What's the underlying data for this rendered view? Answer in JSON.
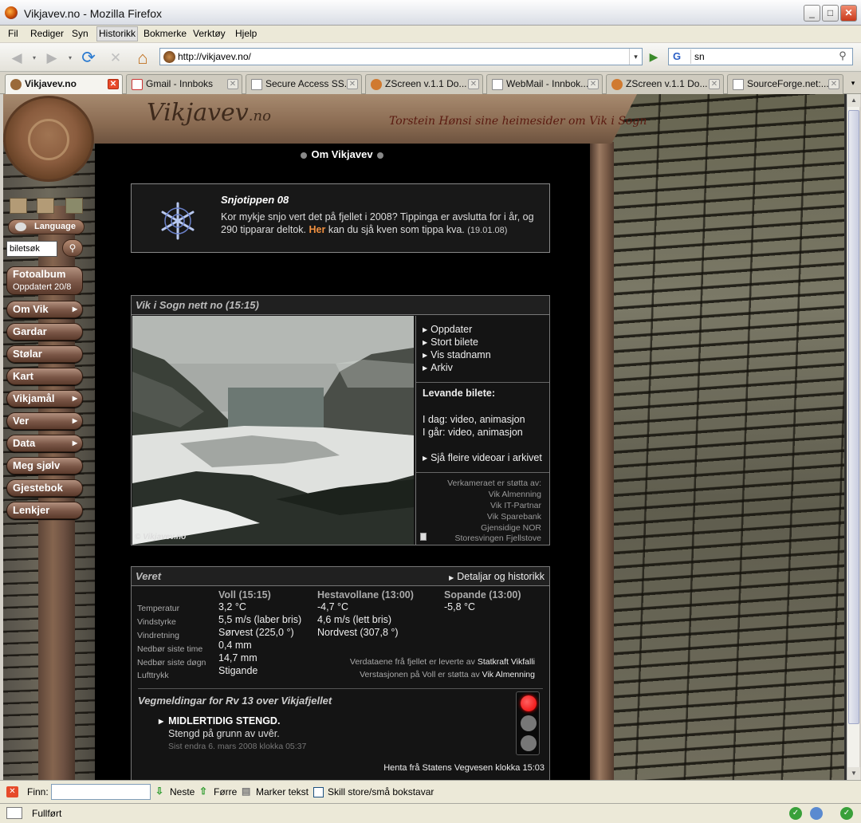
{
  "window": {
    "title": "Vikjavev.no - Mozilla Firefox",
    "min": "_",
    "max": "□",
    "close": "✕"
  },
  "menu": [
    "Fil",
    "Rediger",
    "Syn",
    "Historikk",
    "Bokmerke",
    "Verktøy",
    "Hjelp"
  ],
  "nav": {
    "back": "◀",
    "forward": "▶",
    "reload": "⟳",
    "stop": "✕",
    "home": "⌂",
    "url": "http://vikjavev.no/",
    "go": "▶",
    "search_engine": "G",
    "search_value": "sn",
    "dropdown": "▾",
    "search_btn": "⚲"
  },
  "tabs": [
    {
      "label": "Vikjavev.no",
      "active": true
    },
    {
      "label": "Gmail - Innboks",
      "active": false
    },
    {
      "label": "Secure Access SS...",
      "active": false
    },
    {
      "label": "ZScreen v.1.1 Do...",
      "active": false
    },
    {
      "label": "WebMail - Innbok...",
      "active": false
    },
    {
      "label": "ZScreen v.1.1 Do...",
      "active": false
    },
    {
      "label": "SourceForge.net:...",
      "active": false
    }
  ],
  "tab_close": "✕",
  "tab_list": "▾",
  "site": {
    "logo": "Vikjavev",
    "logo_suffix": ".no",
    "tagline": "Torstein Hønsi sine heimesider om Vik i Sogn",
    "page_title": "Om Vikjavev",
    "language": "Language",
    "image_search_placeholder": "biletsøk",
    "search_btn": "⚲",
    "fotoalbum": {
      "title": "Fotoalbum",
      "sub": "Oppdatert 20/8"
    },
    "nav_items": [
      {
        "label": "Om Vik",
        "arrow": "▶"
      },
      {
        "label": "Gardar",
        "arrow": ""
      },
      {
        "label": "Stølar",
        "arrow": ""
      },
      {
        "label": "Kart",
        "arrow": ""
      },
      {
        "label": "Vikjamål",
        "arrow": "▶"
      },
      {
        "label": "Ver",
        "arrow": "▶"
      },
      {
        "label": "Data",
        "arrow": "▶"
      },
      {
        "label": "Meg sjølv",
        "arrow": ""
      },
      {
        "label": "Gjestebok",
        "arrow": ""
      },
      {
        "label": "Lenkjer",
        "arrow": ""
      }
    ]
  },
  "snjo": {
    "title": "Snjotippen 08",
    "text1": "Kor mykje snjo vert det på fjellet i 2008? Tippinga er avslutta for i år, og 290 tipparar deltok.",
    "her": "Her",
    "text2": "kan du sjå kven som tippa kva.",
    "date": "(19.01.08)"
  },
  "webcam": {
    "header": "Vik i Sogn nett no (15:15)",
    "watermark": "© Vikjavev.no",
    "links": [
      "Oppdater",
      "Stort bilete",
      "Vis stadnamn",
      "Arkiv"
    ],
    "live_title": "Levande bilete:",
    "today": "I dag: video, animasjon",
    "yesterday": "I går: video, animasjon",
    "more": "Sjå fleire videoar i arkivet",
    "sponsors": [
      "Verkameraet er støtta av:",
      "Vik Almenning",
      "Vik IT-Partnar",
      "Vik Sparebank",
      "Gjensidige NOR",
      "Storesvingen Fjellstove"
    ]
  },
  "weather": {
    "header": "Veret",
    "details": "Detaljar og historikk",
    "labels": [
      "Temperatur",
      "Vindstyrke",
      "Vindretning",
      "Nedbør siste time",
      "Nedbør siste døgn",
      "Lufttrykk"
    ],
    "stations": [
      {
        "name": "Voll (15:15)",
        "values": [
          "3,2 °C",
          "5,5 m/s (laber bris)",
          "Sørvest (225,0 °)",
          "0,4 mm",
          "14,7 mm",
          "Stigande"
        ]
      },
      {
        "name": "Hestavollane (13:00)",
        "values": [
          "-4,7 °C",
          "4,6 m/s (lett bris)",
          "Nordvest (307,8 °)"
        ]
      },
      {
        "name": "Sopande (13:00)",
        "values": [
          "-5,8 °C"
        ]
      }
    ],
    "note1_pre": "Verdataene frå fjellet er leverte av",
    "note1_link": "Statkraft Vikfalli",
    "note2_pre": "Verstasjonen på Voll er støtta av",
    "note2_link": "Vik Almenning"
  },
  "road": {
    "title": "Vegmeldingar for Rv 13 over Vikjafjellet",
    "status": "MIDLERTIDIG STENGD.",
    "desc": "Stengd på grunn av uvêr.",
    "changed": "Sist endra 6. mars 2008 klokka 05:37",
    "source": "Henta frå Statens Vegvesen klokka 15:03",
    "light": "red"
  },
  "findbar": {
    "label": "Finn:",
    "next": "Neste",
    "prev": "Førre",
    "highlight": "Marker tekst",
    "matchcase": "Skill store/små bokstavar",
    "close": "✕",
    "next_arrow": "⇩",
    "prev_arrow": "⇧",
    "mark": "▤"
  },
  "status": {
    "text": "Fullført",
    "ok": "✓"
  },
  "colors": {
    "accent_orange": "#f09040",
    "traffic_red": "#ee0000",
    "wood": "#8a6b52"
  }
}
